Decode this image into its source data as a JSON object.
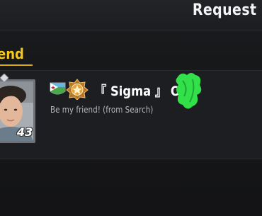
{
  "header": {
    "title": "Request L"
  },
  "tabs": {
    "active_label": "end"
  },
  "request": {
    "player_name": "『 Sigma 』 OP",
    "message": "Be my friend! (from Search)",
    "level": "43",
    "flag_icon": "flag-icon",
    "tier_icon": "tier-badge-icon",
    "accent_color": "#f3c623"
  }
}
